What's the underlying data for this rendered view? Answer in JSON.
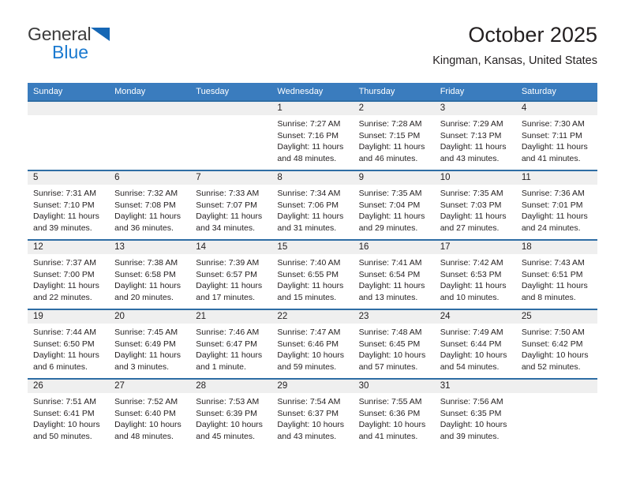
{
  "brand": {
    "line1": "General",
    "line2": "Blue",
    "triangle_color": "#1567b5",
    "text_color": "#3b3b3b",
    "blue_text_color": "#1b7ad0"
  },
  "header": {
    "title": "October 2025",
    "subtitle": "Kingman, Kansas, United States"
  },
  "colors": {
    "header_bar": "#3a7cbe",
    "row_separator": "#2e6da4",
    "day_strip": "#efefef",
    "text": "#231f20"
  },
  "weekday_headers": [
    "Sunday",
    "Monday",
    "Tuesday",
    "Wednesday",
    "Thursday",
    "Friday",
    "Saturday"
  ],
  "labels": {
    "sunrise_prefix": "Sunrise:",
    "sunset_prefix": "Sunset:",
    "daylight_prefix": "Daylight:"
  },
  "weeks": [
    [
      {
        "day": "",
        "sunrise": "",
        "sunset": "",
        "daylight": ""
      },
      {
        "day": "",
        "sunrise": "",
        "sunset": "",
        "daylight": ""
      },
      {
        "day": "",
        "sunrise": "",
        "sunset": "",
        "daylight": ""
      },
      {
        "day": "1",
        "sunrise": "Sunrise: 7:27 AM",
        "sunset": "Sunset: 7:16 PM",
        "daylight": "Daylight: 11 hours and 48 minutes."
      },
      {
        "day": "2",
        "sunrise": "Sunrise: 7:28 AM",
        "sunset": "Sunset: 7:15 PM",
        "daylight": "Daylight: 11 hours and 46 minutes."
      },
      {
        "day": "3",
        "sunrise": "Sunrise: 7:29 AM",
        "sunset": "Sunset: 7:13 PM",
        "daylight": "Daylight: 11 hours and 43 minutes."
      },
      {
        "day": "4",
        "sunrise": "Sunrise: 7:30 AM",
        "sunset": "Sunset: 7:11 PM",
        "daylight": "Daylight: 11 hours and 41 minutes."
      }
    ],
    [
      {
        "day": "5",
        "sunrise": "Sunrise: 7:31 AM",
        "sunset": "Sunset: 7:10 PM",
        "daylight": "Daylight: 11 hours and 39 minutes."
      },
      {
        "day": "6",
        "sunrise": "Sunrise: 7:32 AM",
        "sunset": "Sunset: 7:08 PM",
        "daylight": "Daylight: 11 hours and 36 minutes."
      },
      {
        "day": "7",
        "sunrise": "Sunrise: 7:33 AM",
        "sunset": "Sunset: 7:07 PM",
        "daylight": "Daylight: 11 hours and 34 minutes."
      },
      {
        "day": "8",
        "sunrise": "Sunrise: 7:34 AM",
        "sunset": "Sunset: 7:06 PM",
        "daylight": "Daylight: 11 hours and 31 minutes."
      },
      {
        "day": "9",
        "sunrise": "Sunrise: 7:35 AM",
        "sunset": "Sunset: 7:04 PM",
        "daylight": "Daylight: 11 hours and 29 minutes."
      },
      {
        "day": "10",
        "sunrise": "Sunrise: 7:35 AM",
        "sunset": "Sunset: 7:03 PM",
        "daylight": "Daylight: 11 hours and 27 minutes."
      },
      {
        "day": "11",
        "sunrise": "Sunrise: 7:36 AM",
        "sunset": "Sunset: 7:01 PM",
        "daylight": "Daylight: 11 hours and 24 minutes."
      }
    ],
    [
      {
        "day": "12",
        "sunrise": "Sunrise: 7:37 AM",
        "sunset": "Sunset: 7:00 PM",
        "daylight": "Daylight: 11 hours and 22 minutes."
      },
      {
        "day": "13",
        "sunrise": "Sunrise: 7:38 AM",
        "sunset": "Sunset: 6:58 PM",
        "daylight": "Daylight: 11 hours and 20 minutes."
      },
      {
        "day": "14",
        "sunrise": "Sunrise: 7:39 AM",
        "sunset": "Sunset: 6:57 PM",
        "daylight": "Daylight: 11 hours and 17 minutes."
      },
      {
        "day": "15",
        "sunrise": "Sunrise: 7:40 AM",
        "sunset": "Sunset: 6:55 PM",
        "daylight": "Daylight: 11 hours and 15 minutes."
      },
      {
        "day": "16",
        "sunrise": "Sunrise: 7:41 AM",
        "sunset": "Sunset: 6:54 PM",
        "daylight": "Daylight: 11 hours and 13 minutes."
      },
      {
        "day": "17",
        "sunrise": "Sunrise: 7:42 AM",
        "sunset": "Sunset: 6:53 PM",
        "daylight": "Daylight: 11 hours and 10 minutes."
      },
      {
        "day": "18",
        "sunrise": "Sunrise: 7:43 AM",
        "sunset": "Sunset: 6:51 PM",
        "daylight": "Daylight: 11 hours and 8 minutes."
      }
    ],
    [
      {
        "day": "19",
        "sunrise": "Sunrise: 7:44 AM",
        "sunset": "Sunset: 6:50 PM",
        "daylight": "Daylight: 11 hours and 6 minutes."
      },
      {
        "day": "20",
        "sunrise": "Sunrise: 7:45 AM",
        "sunset": "Sunset: 6:49 PM",
        "daylight": "Daylight: 11 hours and 3 minutes."
      },
      {
        "day": "21",
        "sunrise": "Sunrise: 7:46 AM",
        "sunset": "Sunset: 6:47 PM",
        "daylight": "Daylight: 11 hours and 1 minute."
      },
      {
        "day": "22",
        "sunrise": "Sunrise: 7:47 AM",
        "sunset": "Sunset: 6:46 PM",
        "daylight": "Daylight: 10 hours and 59 minutes."
      },
      {
        "day": "23",
        "sunrise": "Sunrise: 7:48 AM",
        "sunset": "Sunset: 6:45 PM",
        "daylight": "Daylight: 10 hours and 57 minutes."
      },
      {
        "day": "24",
        "sunrise": "Sunrise: 7:49 AM",
        "sunset": "Sunset: 6:44 PM",
        "daylight": "Daylight: 10 hours and 54 minutes."
      },
      {
        "day": "25",
        "sunrise": "Sunrise: 7:50 AM",
        "sunset": "Sunset: 6:42 PM",
        "daylight": "Daylight: 10 hours and 52 minutes."
      }
    ],
    [
      {
        "day": "26",
        "sunrise": "Sunrise: 7:51 AM",
        "sunset": "Sunset: 6:41 PM",
        "daylight": "Daylight: 10 hours and 50 minutes."
      },
      {
        "day": "27",
        "sunrise": "Sunrise: 7:52 AM",
        "sunset": "Sunset: 6:40 PM",
        "daylight": "Daylight: 10 hours and 48 minutes."
      },
      {
        "day": "28",
        "sunrise": "Sunrise: 7:53 AM",
        "sunset": "Sunset: 6:39 PM",
        "daylight": "Daylight: 10 hours and 45 minutes."
      },
      {
        "day": "29",
        "sunrise": "Sunrise: 7:54 AM",
        "sunset": "Sunset: 6:37 PM",
        "daylight": "Daylight: 10 hours and 43 minutes."
      },
      {
        "day": "30",
        "sunrise": "Sunrise: 7:55 AM",
        "sunset": "Sunset: 6:36 PM",
        "daylight": "Daylight: 10 hours and 41 minutes."
      },
      {
        "day": "31",
        "sunrise": "Sunrise: 7:56 AM",
        "sunset": "Sunset: 6:35 PM",
        "daylight": "Daylight: 10 hours and 39 minutes."
      },
      {
        "day": "",
        "sunrise": "",
        "sunset": "",
        "daylight": ""
      }
    ]
  ]
}
